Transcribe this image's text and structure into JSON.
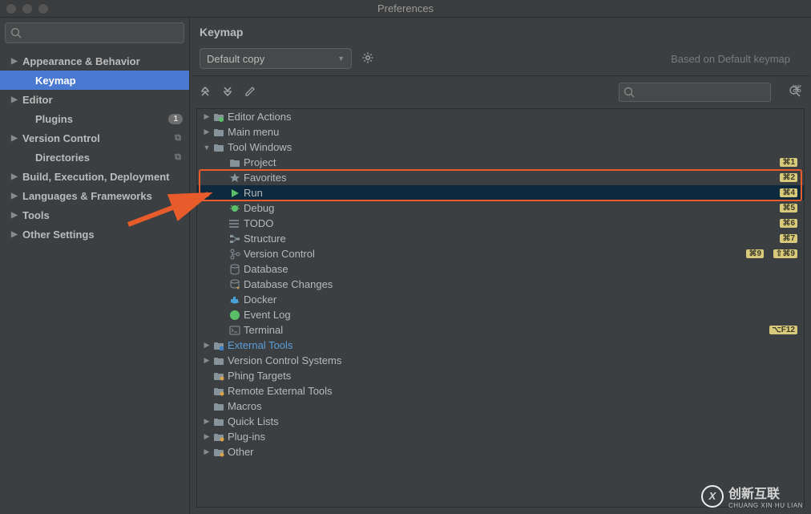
{
  "window": {
    "title": "Preferences"
  },
  "sidebar": {
    "search_placeholder": "",
    "items": [
      {
        "label": "Appearance & Behavior",
        "arrow": true
      },
      {
        "label": "Keymap",
        "arrow": false,
        "child": true,
        "selected": true
      },
      {
        "label": "Editor",
        "arrow": true
      },
      {
        "label": "Plugins",
        "arrow": false,
        "child": true,
        "count": "1"
      },
      {
        "label": "Version Control",
        "arrow": true,
        "badge": "⧉"
      },
      {
        "label": "Directories",
        "arrow": false,
        "child": true,
        "badge": "⧉"
      },
      {
        "label": "Build, Execution, Deployment",
        "arrow": true
      },
      {
        "label": "Languages & Frameworks",
        "arrow": true
      },
      {
        "label": "Tools",
        "arrow": true
      },
      {
        "label": "Other Settings",
        "arrow": true
      }
    ]
  },
  "main": {
    "title": "Keymap",
    "scheme": "Default copy",
    "based_on": "Based on Default keymap",
    "search_placeholder": ""
  },
  "tree": [
    {
      "depth": 1,
      "arrow": "▶",
      "icon": "folder-a",
      "label": "Editor Actions"
    },
    {
      "depth": 1,
      "arrow": "▶",
      "icon": "folder",
      "label": "Main menu"
    },
    {
      "depth": 1,
      "arrow": "▼",
      "icon": "folder",
      "label": "Tool Windows"
    },
    {
      "depth": 2,
      "arrow": "",
      "icon": "folder",
      "label": "Project",
      "shortcut": "⌘1"
    },
    {
      "depth": 2,
      "arrow": "",
      "icon": "star",
      "label": "Favorites",
      "shortcut": "⌘2",
      "hi": true
    },
    {
      "depth": 2,
      "arrow": "",
      "icon": "run",
      "label": "Run",
      "shortcut": "⌘4",
      "hi": true,
      "sel": true
    },
    {
      "depth": 2,
      "arrow": "",
      "icon": "debug",
      "label": "Debug",
      "shortcut": "⌘5"
    },
    {
      "depth": 2,
      "arrow": "",
      "icon": "todo",
      "label": "TODO",
      "shortcut": "⌘6"
    },
    {
      "depth": 2,
      "arrow": "",
      "icon": "struct",
      "label": "Structure",
      "shortcut": "⌘7"
    },
    {
      "depth": 2,
      "arrow": "",
      "icon": "vcs",
      "label": "Version Control",
      "shortcut": "⌘9",
      "shortcut2": "⇧⌘9"
    },
    {
      "depth": 2,
      "arrow": "",
      "icon": "db",
      "label": "Database"
    },
    {
      "depth": 2,
      "arrow": "",
      "icon": "dbch",
      "label": "Database Changes"
    },
    {
      "depth": 2,
      "arrow": "",
      "icon": "docker",
      "label": "Docker"
    },
    {
      "depth": 2,
      "arrow": "",
      "icon": "event",
      "label": "Event Log"
    },
    {
      "depth": 2,
      "arrow": "",
      "icon": "term",
      "label": "Terminal",
      "shortcut": "⌥F12"
    },
    {
      "depth": 1,
      "arrow": "▶",
      "icon": "folder-b",
      "label": "External Tools",
      "link": true
    },
    {
      "depth": 1,
      "arrow": "▶",
      "icon": "folder",
      "label": "Version Control Systems"
    },
    {
      "depth": 1,
      "arrow": "",
      "icon": "folder-c",
      "label": "Phing Targets"
    },
    {
      "depth": 1,
      "arrow": "",
      "icon": "folder-c",
      "label": "Remote External Tools"
    },
    {
      "depth": 1,
      "arrow": "",
      "icon": "folder",
      "label": "Macros"
    },
    {
      "depth": 1,
      "arrow": "▶",
      "icon": "folder",
      "label": "Quick Lists"
    },
    {
      "depth": 1,
      "arrow": "▶",
      "icon": "folder-c",
      "label": "Plug-ins"
    },
    {
      "depth": 1,
      "arrow": "▶",
      "icon": "folder-c",
      "label": "Other"
    }
  ],
  "watermark": {
    "brand": "创新互联",
    "sub": "CHUANG XIN HU LIAN"
  }
}
